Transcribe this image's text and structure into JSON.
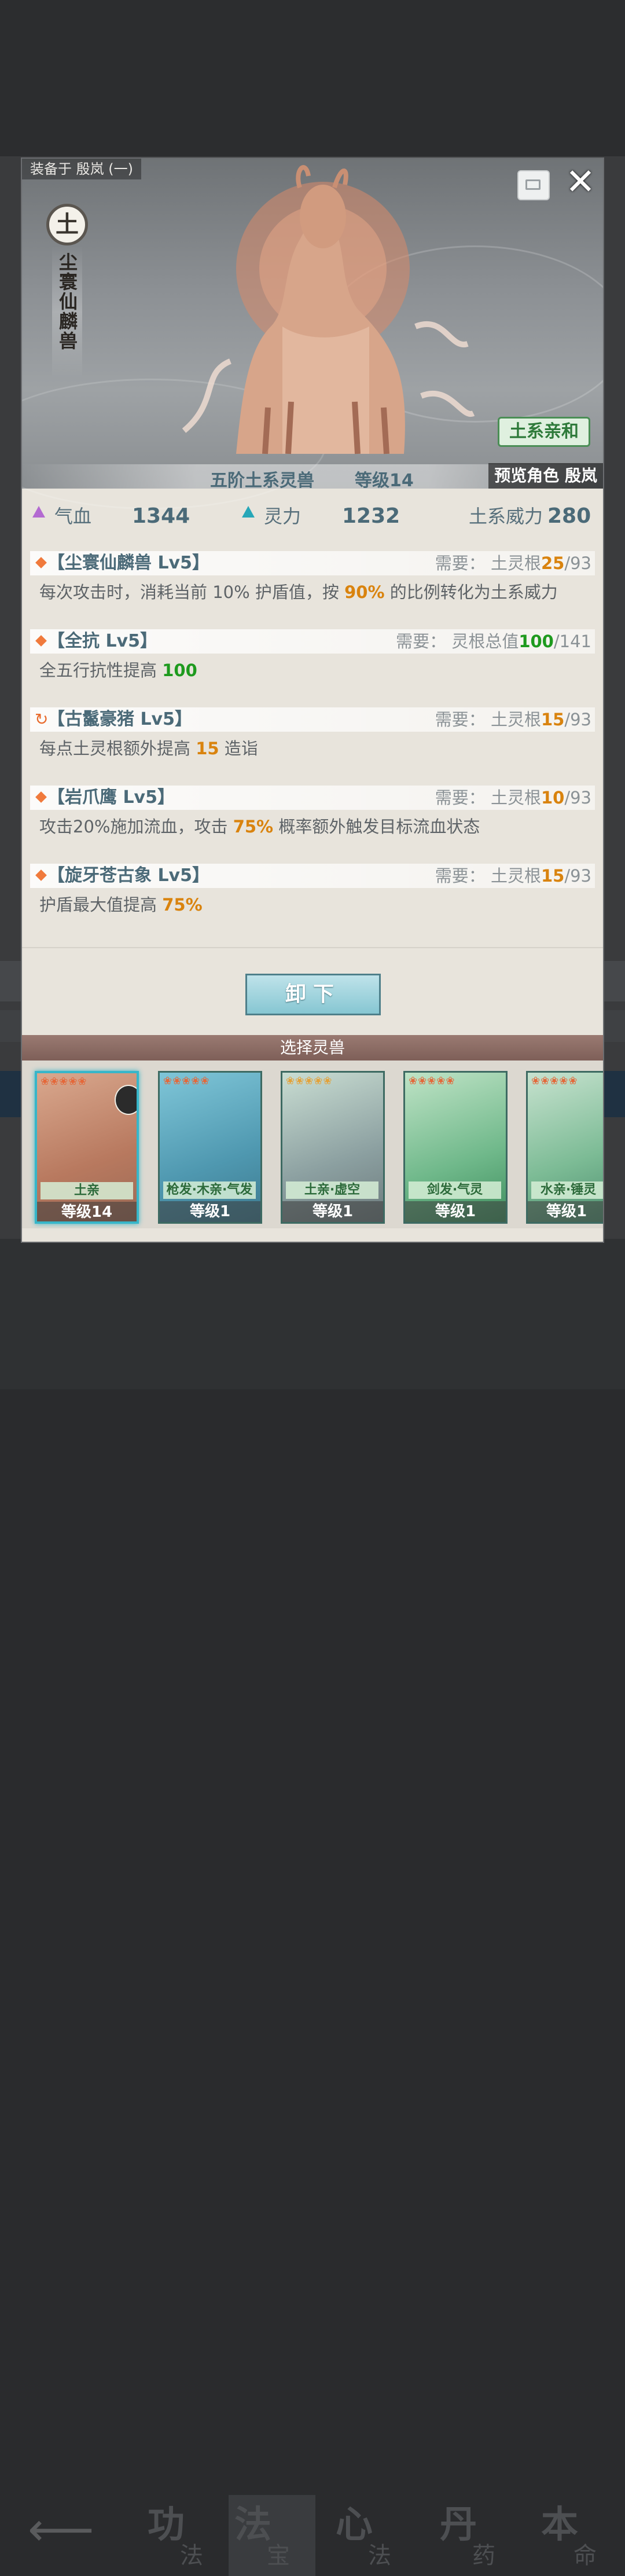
{
  "header": {
    "equipped_on": "装备于 殷岚 (一)",
    "element": "土",
    "beast_name": "尘寰仙麟兽",
    "affinity": "土系亲和",
    "tier": "五阶土系灵兽",
    "level": "等级14",
    "preview": "预览角色 殷岚"
  },
  "stats": {
    "hp_label": "气血",
    "hp_value": "1344",
    "spirit_label": "灵力",
    "spirit_value": "1232",
    "power_label": "土系威力",
    "power_value": "280"
  },
  "skills": [
    {
      "name": "【尘寰仙麟兽 Lv5】",
      "req_label": "需要：",
      "req_type": "土灵根",
      "req_cur": "25",
      "req_max": "/93",
      "desc_a": "每次攻击时，消耗当前 10% 护盾值，按 ",
      "desc_hl": "90%",
      "desc_b": " 的比例转化为土系威力"
    },
    {
      "name": "【全抗 Lv5】",
      "req_label": "需要：",
      "req_type": "灵根总值",
      "req_cur": "100",
      "req_max": "/141",
      "desc_a": "全五行抗性提高 ",
      "desc_hl": "100",
      "desc_b": ""
    },
    {
      "name": "【古鬣豪猪 Lv5】",
      "req_label": "需要：",
      "req_type": "土灵根",
      "req_cur": "15",
      "req_max": "/93",
      "desc_a": "每点土灵根额外提高 ",
      "desc_hl": "15",
      "desc_b": " 造诣"
    },
    {
      "name": "【岩爪鹰 Lv5】",
      "req_label": "需要：",
      "req_type": "土灵根",
      "req_cur": "10",
      "req_max": "/93",
      "desc_a": "攻击20%施加流血，攻击 ",
      "desc_hl": "75%",
      "desc_b": " 概率额外触发目标流血状态"
    },
    {
      "name": "【旋牙苍古象 Lv5】",
      "req_label": "需要：",
      "req_type": "土灵根",
      "req_cur": "15",
      "req_max": "/93",
      "desc_a": "护盾最大值提高 ",
      "desc_hl": "75%",
      "desc_b": ""
    }
  ],
  "unequip_label": "卸下",
  "select_title": "选择灵兽",
  "cards": [
    {
      "tag": "土亲",
      "level": "等级14"
    },
    {
      "tag": "枪发·木亲·气发",
      "level": "等级1"
    },
    {
      "tag": "土亲·虚空",
      "level": "等级1"
    },
    {
      "tag": "剑发·气灵",
      "level": "等级1"
    },
    {
      "tag": "水亲·锤灵",
      "level": "等级1"
    }
  ],
  "nav": {
    "tab1_big": "功",
    "tab1_small": "法",
    "tab2_big": "法",
    "tab2_small": "宝",
    "tab3_big": "心",
    "tab3_small": "法",
    "tab4_big": "丹",
    "tab4_small": "药",
    "tab5_big": "本",
    "tab5_small": "命"
  },
  "colors": {
    "accent_teal": "#37b6c9",
    "highlight_orange": "#d9830e",
    "highlight_green": "#1e9a1e",
    "text_blue_grey": "#4b6a78"
  },
  "icons": [
    "back-arrow-icon",
    "close-icon",
    "collapse-icon",
    "hp-triangle-icon",
    "spirit-triangle-icon",
    "diamond-icon",
    "refresh-icon"
  ]
}
